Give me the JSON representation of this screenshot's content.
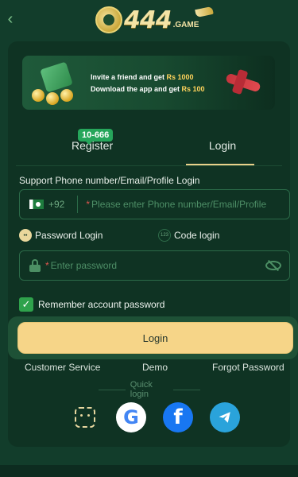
{
  "header": {
    "back_icon": "chevron-left-icon",
    "logo_text": "444",
    "logo_suffix": ".GAME"
  },
  "banner": {
    "line1_prefix": "Invite a friend and get ",
    "line1_amount": "Rs 1000",
    "line2_prefix": "Download the app and get ",
    "line2_amount": "Rs 100"
  },
  "tabs": {
    "register_label": "Register",
    "register_badge": "10-666",
    "login_label": "Login"
  },
  "form": {
    "support_label": "Support Phone number/Email/Profile Login",
    "phone_country_code": "+92",
    "phone_placeholder": "Please enter Phone number/Email/Profile",
    "password_login_label": "Password Login",
    "code_login_label": "Code login",
    "code_icon_text": "123",
    "password_placeholder": "Enter password",
    "remember_label": "Remember account password",
    "remember_checked": true,
    "login_button": "Login"
  },
  "links": {
    "customer_service": "Customer Service",
    "demo": "Demo",
    "forgot_password": "Forgot Password"
  },
  "quick_login": {
    "label": "Quick login",
    "methods": [
      "face-id-icon",
      "google-icon",
      "facebook-icon",
      "telegram-icon"
    ]
  },
  "colors": {
    "background": "#123d2b",
    "card": "#0f3323",
    "accent_gold": "#f6d588",
    "badge_green": "#26a65b",
    "checkbox_green": "#2fa24c"
  }
}
